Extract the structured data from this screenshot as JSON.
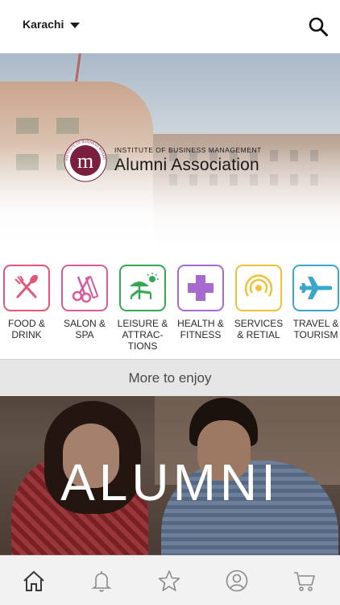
{
  "header": {
    "city": "Karachi",
    "icons": {
      "dropdown": "caret-down-icon",
      "search": "search-icon"
    }
  },
  "hero": {
    "logo": {
      "institute": "INSTITUTE OF BUSINESS MANAGEMENT",
      "association": "Alumni Association",
      "seal_text": "INSTITUTE OF BUSINESS MANAGEMENT",
      "seal_letter": "m",
      "seal_color": "#7a1f3d"
    }
  },
  "categories": [
    {
      "label": "FOOD &\nDRINK",
      "icon": "fork-spoon-icon",
      "color": "#e0577a"
    },
    {
      "label": "SALON &\nSPA",
      "icon": "scissors-comb-icon",
      "color": "#d65a9c"
    },
    {
      "label": "LEISURE &\nATTRAC-\nTIONS",
      "icon": "sun-lounger-icon",
      "color": "#34a853"
    },
    {
      "label": "HEALTH &\nFITNESS",
      "icon": "plus-cross-icon",
      "color": "#a86ad0"
    },
    {
      "label": "SERVICES\n& RETIAL",
      "icon": "signal-rings-icon",
      "color": "#f0c23a"
    },
    {
      "label": "TRAVEL &\nTOURISM",
      "icon": "airplane-icon",
      "color": "#3aa7c9"
    }
  ],
  "more": {
    "label": "More to enjoy"
  },
  "banner": {
    "word": "ALUMNI"
  },
  "nav": {
    "items": [
      {
        "icon": "home-icon",
        "active": true
      },
      {
        "icon": "bell-icon",
        "active": false
      },
      {
        "icon": "star-icon",
        "active": false
      },
      {
        "icon": "profile-icon",
        "active": false
      },
      {
        "icon": "cart-icon",
        "active": false
      }
    ]
  }
}
